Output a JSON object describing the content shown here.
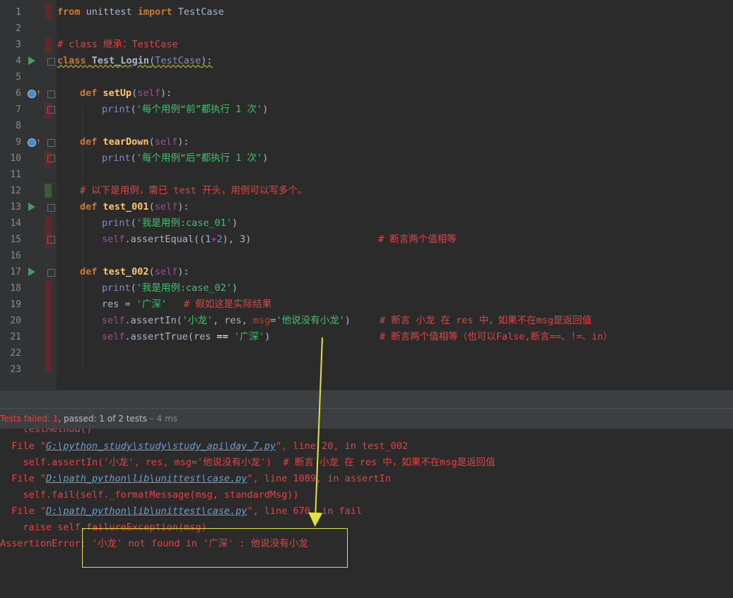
{
  "editor": {
    "lines": [
      {
        "n": "1"
      },
      {
        "n": "2"
      },
      {
        "n": "3"
      },
      {
        "n": "4"
      },
      {
        "n": "5"
      },
      {
        "n": "6"
      },
      {
        "n": "7"
      },
      {
        "n": "8"
      },
      {
        "n": "9"
      },
      {
        "n": "10"
      },
      {
        "n": "11"
      },
      {
        "n": "12"
      },
      {
        "n": "13"
      },
      {
        "n": "14"
      },
      {
        "n": "15"
      },
      {
        "n": "16"
      },
      {
        "n": "17"
      },
      {
        "n": "18"
      },
      {
        "n": "19"
      },
      {
        "n": "20"
      },
      {
        "n": "21"
      },
      {
        "n": "22"
      },
      {
        "n": "23"
      }
    ],
    "code": {
      "l1": {
        "kw1": "from",
        "t1": " unittest ",
        "kw2": "import",
        "t2": " TestCase"
      },
      "l3": {
        "cmt": "# class 继承：TestCase"
      },
      "l4": {
        "kw": "class",
        "name": "Test_Login",
        "p1": "(",
        "base": "TestCase",
        "p2": "):"
      },
      "l6": {
        "kw": "def",
        "fn": "setUp",
        "p1": "(",
        "self": "self",
        "p2": "):"
      },
      "l7": {
        "fn": "print",
        "p1": "(",
        "str": "'每个用例“前”都执行 1 次'",
        "p2": ")"
      },
      "l9": {
        "kw": "def",
        "fn": "tearDown",
        "p1": "(",
        "self": "self",
        "p2": "):"
      },
      "l10": {
        "fn": "print",
        "p1": "(",
        "str": "'每个用例“后”都执行 1 次'",
        "p2": ")"
      },
      "l12": {
        "cmt": "# 以下是用例，需已 test 开头，用例可以写多个。"
      },
      "l13": {
        "kw": "def",
        "fn": "test_001",
        "p1": "(",
        "self": "self",
        "p2": "):"
      },
      "l14": {
        "fn": "print",
        "p1": "(",
        "str": "'我是用例:case_01'",
        "p2": ")"
      },
      "l15": {
        "self": "self",
        "t1": ".assertEqual((1",
        "op": "+",
        "n": "2",
        "t2": "), 3)",
        "cmt": "# 断言两个值相等"
      },
      "l17": {
        "kw": "def",
        "fn": "test_002",
        "p1": "(",
        "self": "self",
        "p2": "):"
      },
      "l18": {
        "fn": "print",
        "p1": "(",
        "str": "'我是用例:case_02'",
        "p2": ")"
      },
      "l19": {
        "t1": "res = ",
        "str": "'广深'",
        "cmt": "# 假如这是实际结果"
      },
      "l20": {
        "self": "self",
        "t1": ".assertIn(",
        "str1": "'小龙'",
        "t2": ", res, ",
        "param": "msg",
        "eq": "=",
        "str2": "'他说没有小龙'",
        "t3": ")",
        "cmt": "# 断言 小龙 在 res 中，如果不在msg是返回值"
      },
      "l21": {
        "self": "self",
        "t1": ".assertTrue(res ",
        "op": "==",
        "str": "'广深'",
        "t2": ")",
        "cmt": "# 断言两个值相等（也可以False,断言==、!=、in）"
      }
    }
  },
  "status": {
    "failed": "Tests failed: 1",
    "passed": ", passed: 1",
    "of": " of 2 tests",
    "time": " – 4 ms"
  },
  "console": {
    "l0": "    testMethod()",
    "l1_pre": "  File \"",
    "l1_link": "G:\\python_study\\study\\study_api\\day_7.py",
    "l1_post": "\", line 20, in test_002",
    "l2": "    self.assertIn('小龙', res, msg='他说没有小龙')  # 断言 小龙 在 res 中，如果不在msg是返回值",
    "l3_pre": "  File \"",
    "l3_link": "D:\\path_python\\lib\\unittest\\case.py",
    "l3_post": "\", line 1089, in assertIn",
    "l4": "    self.fail(self._formatMessage(msg, standardMsg))",
    "l5_pre": "  File \"",
    "l5_link": "D:\\path_python\\lib\\unittest\\case.py",
    "l5_post": "\", line 670, in fail",
    "l6": "    raise self.failureException(msg)",
    "l7": "AssertionError: '小龙' not found in '广深' : 他说没有小龙"
  },
  "colors": {
    "annotation": "#e2e23a",
    "error_text": "#e04545"
  }
}
